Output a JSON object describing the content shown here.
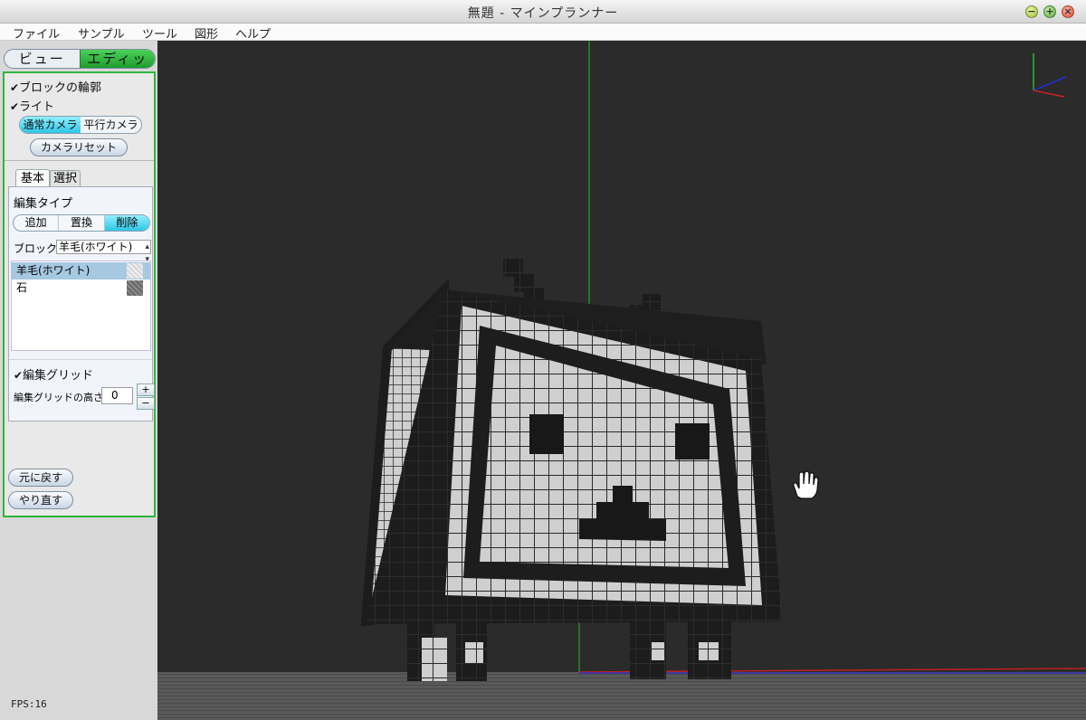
{
  "window": {
    "title": "無題 - マインプランナー"
  },
  "menu": [
    "ファイル",
    "サンプル",
    "ツール",
    "図形",
    "ヘルプ"
  ],
  "mode": {
    "view_label": "ビュー",
    "edit_label": "エディット",
    "selected": "エディット"
  },
  "display": {
    "block_outline": {
      "label": "ブロックの輪郭",
      "checked": true
    },
    "light": {
      "label": "ライト",
      "checked": true
    },
    "camera_normal": "通常カメラ",
    "camera_parallel": "平行カメラ",
    "camera_selected": "通常カメラ",
    "camera_reset": "カメラリセット"
  },
  "tabs": {
    "basic": "基本",
    "select": "選択",
    "active": "基本"
  },
  "edit": {
    "type_label": "編集タイプ",
    "types": [
      "追加",
      "置換",
      "削除"
    ],
    "selected_type": "削除",
    "block_label": "ブロック",
    "block_value": "羊毛(ホワイト)",
    "block_list": [
      {
        "name": "羊毛(ホワイト)",
        "selected": true,
        "color": "#e6e6e6"
      },
      {
        "name": "石",
        "selected": false,
        "color": "#7a7a7a"
      }
    ],
    "grid": {
      "label": "編集グリッド",
      "checked": true
    },
    "grid_height_label": "編集グリッドの高さ",
    "grid_height": "0"
  },
  "history": {
    "undo": "元に戻す",
    "redo": "やり直す"
  },
  "status": {
    "fps": "FPS:16"
  },
  "colors": {
    "viewport_bg": "#2b2b2b",
    "panel_border": "#2fb53d",
    "selected_seg": "#2fc6e6",
    "wool_white": "#d0d0d0",
    "wool_black": "#1e1e1e"
  }
}
